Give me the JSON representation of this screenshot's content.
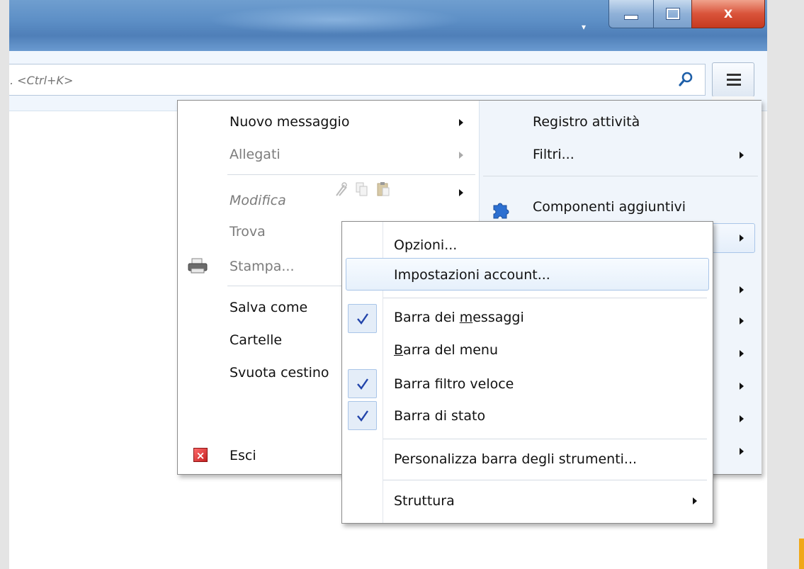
{
  "window": {
    "minimize_icon": "minimize-icon",
    "maximize_icon": "maximize-icon",
    "close_label": "X"
  },
  "search": {
    "placeholder": ". <Ctrl+K>",
    "icon": "search-icon"
  },
  "app_menu": {
    "icon": "hamburger-menu-icon",
    "left": {
      "nuovo_messaggio": "Nuovo messaggio",
      "allegati": "Allegati",
      "modifica": "Modifica",
      "trova": "Trova",
      "stampa": "Stampa...",
      "salva_come": "Salva come",
      "cartelle": "Cartelle",
      "svuota_cestino": "Svuota cestino",
      "esci": "Esci"
    },
    "right": {
      "registro_attivita": "Registro attività",
      "filtri": "Filtri...",
      "componenti_aggiuntivi": "Componenti aggiuntivi"
    }
  },
  "submenu": {
    "opzioni": "Opzioni...",
    "impostazioni_account": "Impostazioni account...",
    "barra_messaggi_pre": "Barra dei ",
    "barra_messaggi_u": "m",
    "barra_messaggi_post": "essaggi",
    "barra_menu_u": "B",
    "barra_menu_post": "arra del menu",
    "barra_filtro_veloce": "Barra filtro veloce",
    "barra_di_stato": "Barra di stato",
    "personalizza": "Personalizza barra degli strumenti...",
    "struttura": "Struttura",
    "checked": {
      "barra_dei_messaggi": true,
      "barra_del_menu": false,
      "barra_filtro_veloce": true,
      "barra_di_stato": true
    }
  },
  "colors": {
    "titlebar": "#5d8fc6",
    "close_button": "#d9533a",
    "check_mark": "#2244aa",
    "highlight_border": "#a9c5e8"
  }
}
